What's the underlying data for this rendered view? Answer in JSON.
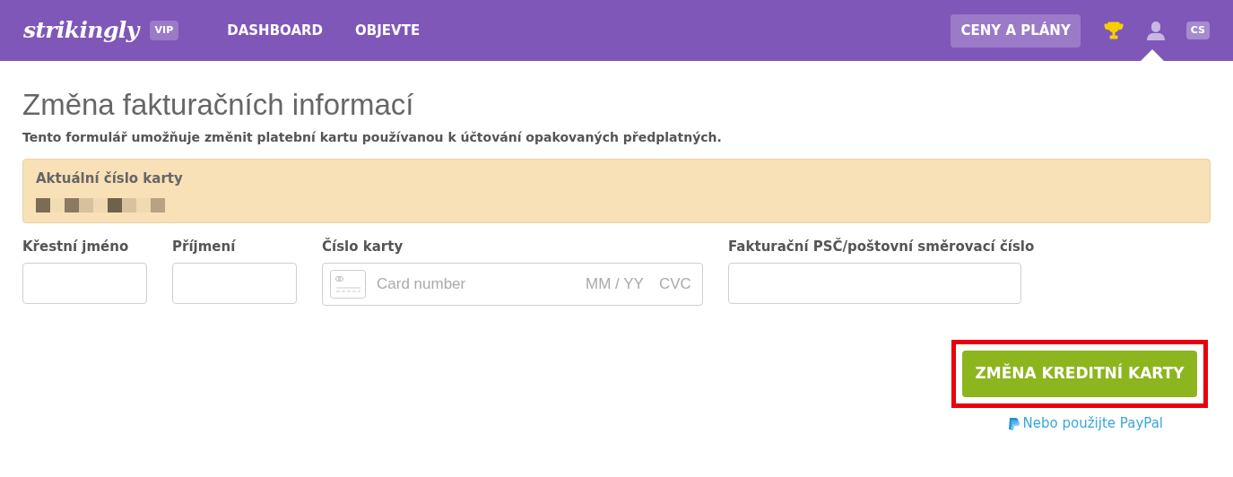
{
  "header": {
    "logo": "strikingly",
    "badge": "VIP",
    "nav": [
      {
        "label": "DASHBOARD"
      },
      {
        "label": "OBJEVTE"
      }
    ],
    "pricing_button": "CENY A PLÁNY",
    "language": "CS"
  },
  "title": "Změna fakturačních informací",
  "subtitle": "Tento formulář umožňuje změnit platební kartu používanou k účtování opakovaných předplatných.",
  "current_card": {
    "label": "Aktuální číslo karty"
  },
  "fields": [
    {
      "kind": "text",
      "label": "Křestní jméno"
    },
    {
      "kind": "text",
      "label": "Příjmení"
    },
    {
      "kind": "card",
      "label": "Číslo karty",
      "placeholder": "Card number",
      "expiry_placeholder": "MM / YY",
      "cvc_placeholder": "CVC"
    },
    {
      "kind": "zip",
      "label": "Fakturační PSČ/poštovní směrovací číslo"
    }
  ],
  "submit_button": "ZMĚNA KREDITNÍ KARTY",
  "paypal_link": "Nebo použijte PayPal"
}
